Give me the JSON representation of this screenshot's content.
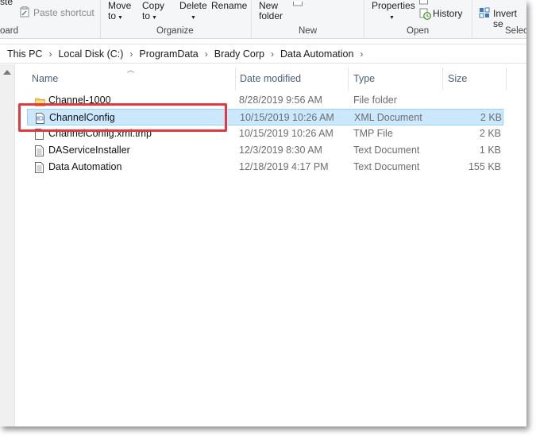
{
  "ribbon": {
    "clipboard": {
      "paste_partial": "ste",
      "paste_shortcut": "Paste shortcut",
      "label_partial": "oard"
    },
    "organize": {
      "move_to": [
        "Move",
        "to"
      ],
      "copy_to": [
        "Copy",
        "to"
      ],
      "delete": "Delete",
      "rename": "Rename",
      "label": "Organize"
    },
    "new": {
      "new_folder": [
        "New",
        "folder"
      ],
      "label": "New"
    },
    "open": {
      "properties": "Properties",
      "history": "History",
      "label": "Open"
    },
    "select": {
      "invert": "Invert se",
      "label": "Selec"
    }
  },
  "address": {
    "crumbs": [
      "This PC",
      "Local Disk (C:)",
      "ProgramData",
      "Brady Corp",
      "Data Automation"
    ]
  },
  "columns": {
    "name": "Name",
    "date": "Date modified",
    "type": "Type",
    "size": "Size"
  },
  "files": [
    {
      "name": "Channel-1000",
      "date": "8/28/2019 9:56 AM",
      "type": "File folder",
      "size": "",
      "icon": "folder-icon",
      "selected": false
    },
    {
      "name": "ChannelConfig",
      "date": "10/15/2019 10:26 AM",
      "type": "XML Document",
      "size": "2 KB",
      "icon": "xml-file-icon",
      "selected": true
    },
    {
      "name": "ChannelConfig.xml.tmp",
      "date": "10/15/2019 10:26 AM",
      "type": "TMP File",
      "size": "2 KB",
      "icon": "file-icon",
      "selected": false
    },
    {
      "name": "DAServiceInstaller",
      "date": "12/3/2019 8:30 AM",
      "type": "Text Document",
      "size": "1 KB",
      "icon": "text-file-icon",
      "selected": false
    },
    {
      "name": "Data Automation",
      "date": "12/18/2019 4:17 PM",
      "type": "Text Document",
      "size": "155 KB",
      "icon": "text-file-icon",
      "selected": false
    }
  ],
  "colors": {
    "selection_bg": "#cce8ff",
    "selection_border": "#99d1ff",
    "highlight_red": "#e0393e",
    "header_text": "#4c607a"
  }
}
